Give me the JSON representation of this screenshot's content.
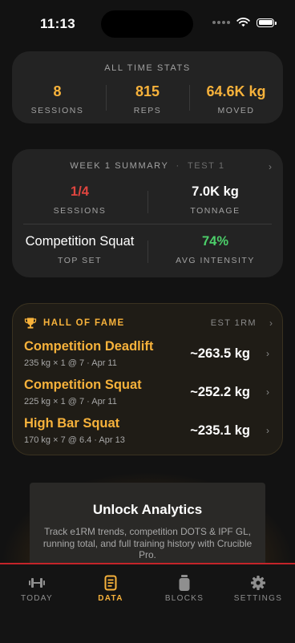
{
  "status_bar": {
    "time": "11:13"
  },
  "all_time": {
    "title": "ALL TIME STATS",
    "stats": [
      {
        "value": "8",
        "label": "SESSIONS"
      },
      {
        "value": "815",
        "label": "REPS"
      },
      {
        "value": "64.6K kg",
        "label": "MOVED"
      }
    ]
  },
  "week": {
    "title": "WEEK 1 SUMMARY",
    "separator": "·",
    "test": "TEST 1",
    "sessions": {
      "value": "1/4",
      "label": "SESSIONS",
      "color": "#e0453f"
    },
    "tonnage": {
      "value": "7.0K kg",
      "label": "TONNAGE"
    },
    "top_set": {
      "value": "Competition Squat",
      "label": "TOP SET"
    },
    "intensity": {
      "value": "74%",
      "label": "AVG INTENSITY",
      "color": "#4ccf6a"
    }
  },
  "hall_of_fame": {
    "title": "HALL OF FAME",
    "metric": "EST 1RM",
    "items": [
      {
        "name": "Competition Deadlift",
        "detail": "235 kg × 1 @ 7 · Apr 11",
        "value": "~263.5 kg"
      },
      {
        "name": "Competition Squat",
        "detail": "225 kg × 1 @ 7 · Apr 11",
        "value": "~252.2 kg"
      },
      {
        "name": "High Bar Squat",
        "detail": "170 kg × 7 @ 6.4 · Apr 13",
        "value": "~235.1 kg"
      }
    ]
  },
  "unlock": {
    "title": "Unlock Analytics",
    "text": "Track e1RM trends, competition DOTS & IPF GL, running total, and full training history with Crucible Pro."
  },
  "tabs": [
    {
      "label": "TODAY",
      "icon": "dumbbell-icon"
    },
    {
      "label": "DATA",
      "icon": "document-icon",
      "active": true
    },
    {
      "label": "BLOCKS",
      "icon": "jar-icon"
    },
    {
      "label": "SETTINGS",
      "icon": "gear-icon"
    }
  ],
  "colors": {
    "accent": "#f7b23b",
    "danger": "#e0453f",
    "success": "#4ccf6a",
    "tab_border": "#c4242a"
  }
}
